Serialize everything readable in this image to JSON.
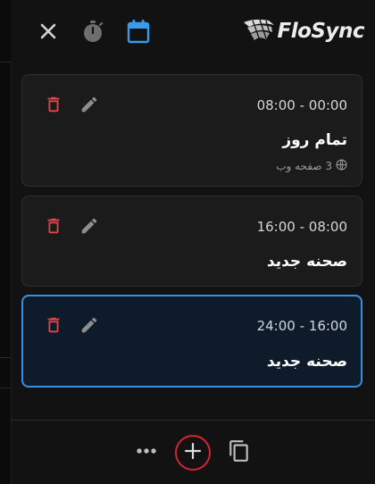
{
  "app": {
    "logo_text": "FloSync"
  },
  "toolbar": {
    "icons": [
      "close-icon",
      "timer-icon",
      "calendar-icon"
    ],
    "active": "calendar-icon",
    "accent": "#3b9bea"
  },
  "cards": [
    {
      "time": "08:00 - 00:00",
      "title": "تمام روز",
      "sub_text": "3 صفحه وب",
      "sub_icon": "globe-icon",
      "selected": false
    },
    {
      "time": "16:00 - 08:00",
      "title": "صحنه جدید",
      "selected": false
    },
    {
      "time": "24:00 - 16:00",
      "title": "صحنه جدید",
      "selected": true
    }
  ],
  "bottom_actions": [
    "more-icon",
    "add-icon",
    "copy-icon"
  ],
  "colors": {
    "delete": "#e0474c",
    "selected_border": "#3b8fe0",
    "highlight_circle": "#d8242f"
  }
}
